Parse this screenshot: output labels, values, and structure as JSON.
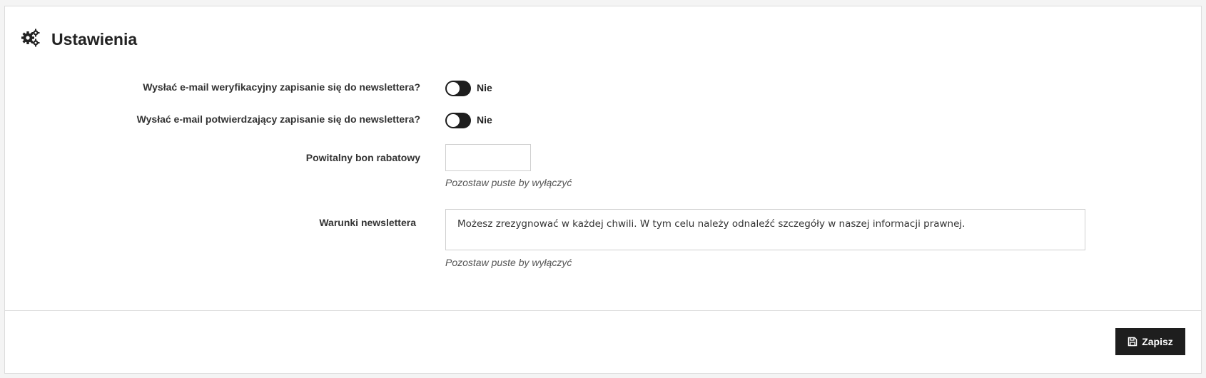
{
  "header": {
    "title": "Ustawienia",
    "icon": "gears-icon"
  },
  "form": {
    "verification_email": {
      "label": "Wysłać e-mail weryfikacyjny zapisanie się do newslettera?",
      "state": "Nie",
      "enabled": false
    },
    "confirmation_email": {
      "label": "Wysłać e-mail potwierdzający zapisanie się do newslettera?",
      "state": "Nie",
      "enabled": false
    },
    "welcome_voucher": {
      "label": "Powitalny bon rabatowy",
      "value": "",
      "help": "Pozostaw puste by wyłączyć"
    },
    "newsletter_terms": {
      "label": "Warunki newslettera",
      "value": "Możesz zrezygnować w każdej chwili. W tym celu należy odnaleźć szczegóły w naszej informacji prawnej.",
      "help": "Pozostaw puste by wyłączyć"
    }
  },
  "footer": {
    "save_label": "Zapisz",
    "save_icon": "floppy-disk-icon"
  },
  "colors": {
    "dark": "#1e1e1e",
    "border": "#dcdcdc"
  }
}
